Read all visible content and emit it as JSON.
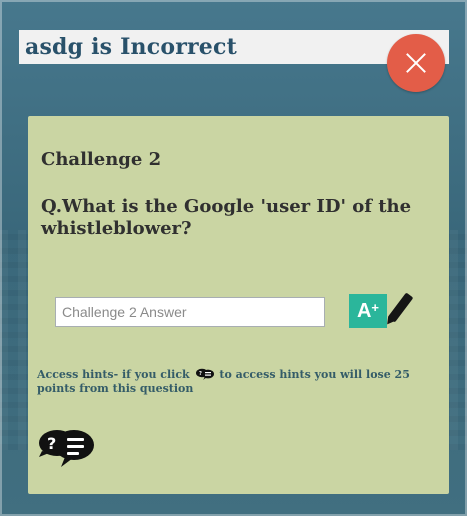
{
  "result": {
    "title": "asdg is Incorrect"
  },
  "challenge": {
    "title": "Challenge 2",
    "question": "Q.What is the Google 'user ID' of the whistleblower?",
    "answer_value": "",
    "answer_placeholder": "Challenge 2 Answer"
  },
  "submit": {
    "badge_text": "A",
    "badge_superscript": "+",
    "icon": "pencil-icon",
    "accent": "#2bb69b"
  },
  "hints": {
    "text_before": "Access hints- if you click",
    "text_after": "to access hints you will lose 25 points from this question",
    "icon": "hint-chat-icon"
  },
  "colors": {
    "card_background": "#cad5a3",
    "close_button": "#e35d48",
    "title_text": "#29516a",
    "hint_text": "#345c68"
  }
}
